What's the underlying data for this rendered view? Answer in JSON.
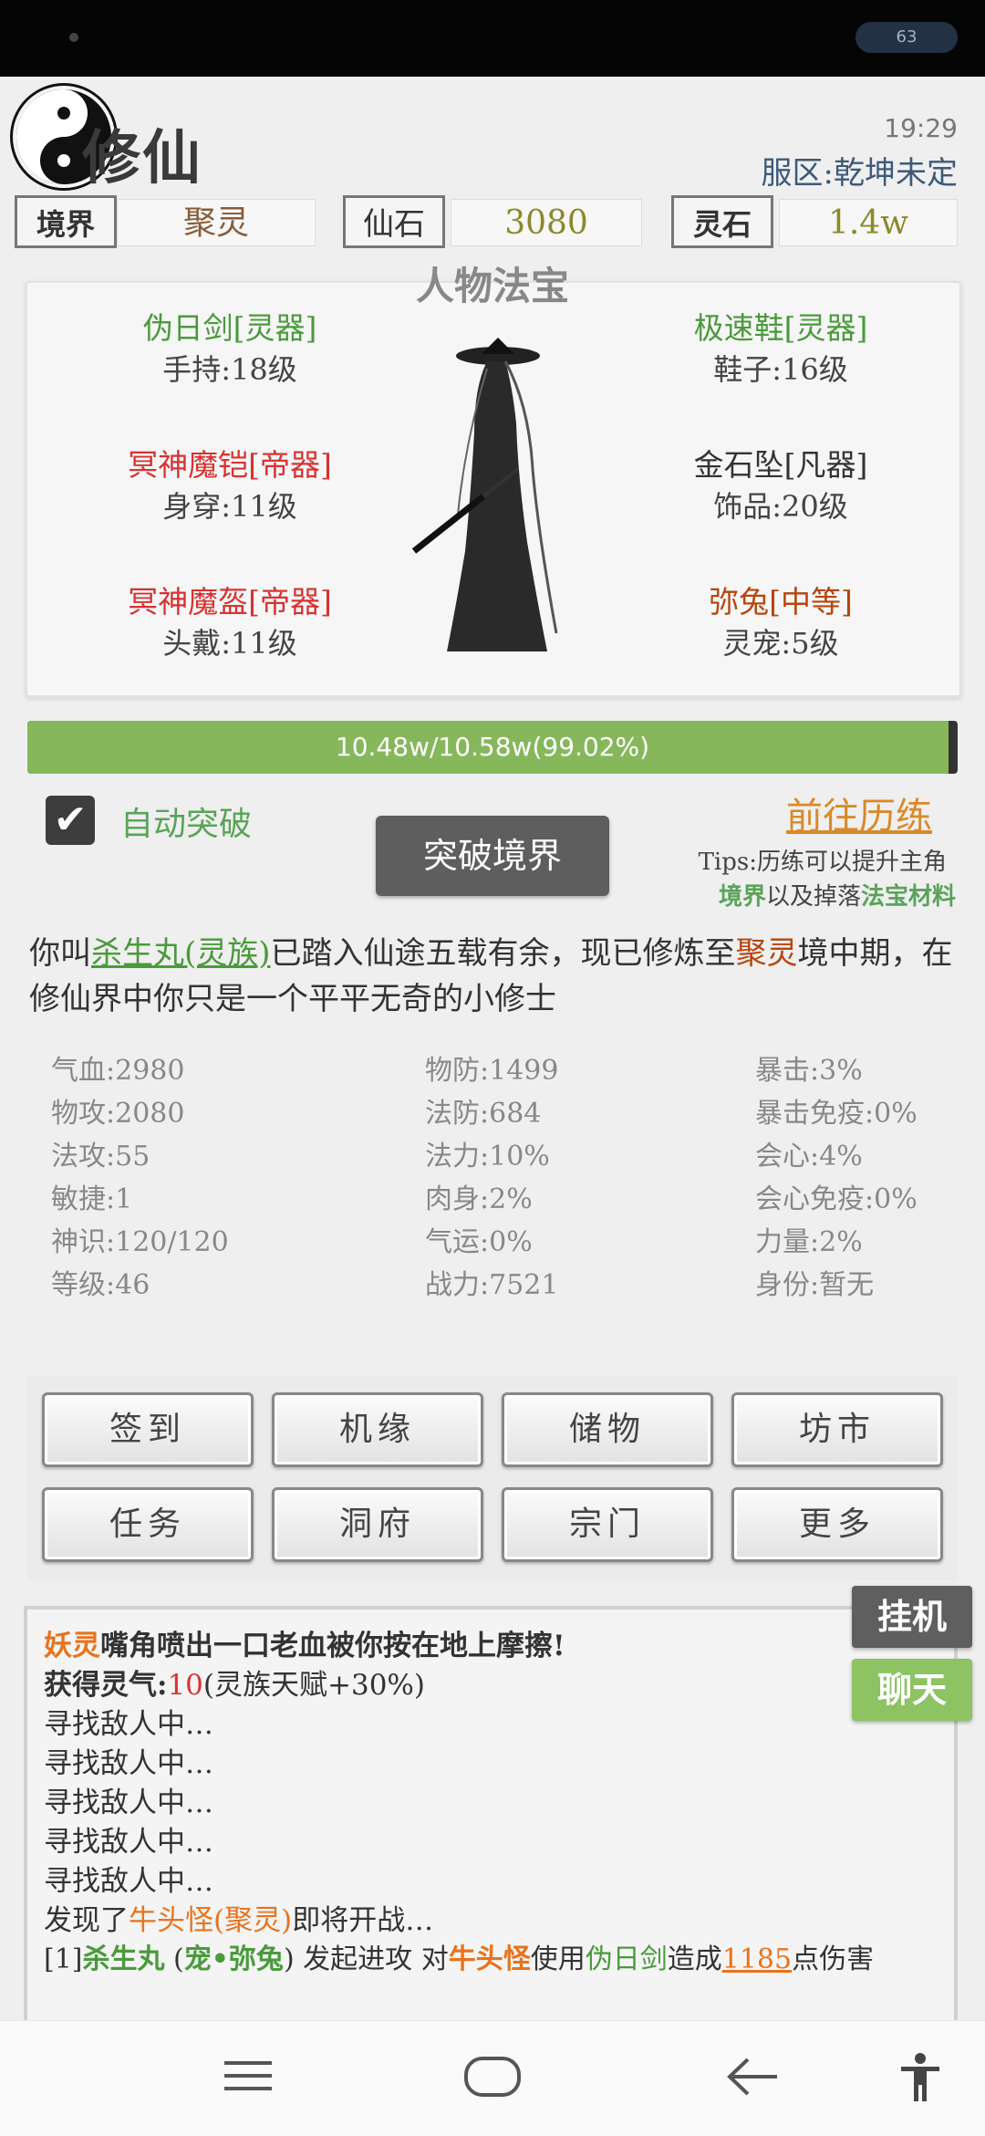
{
  "status_bar": {
    "battery": "63"
  },
  "header": {
    "title": "修仙",
    "time": "19:29",
    "server": "服区:乾坤未定"
  },
  "stats": {
    "realm_label": "境界",
    "realm_value": "聚灵",
    "xianshi_label": "仙石",
    "xianshi_value": "3080",
    "lingshi_label": "灵石",
    "lingshi_value": "1.4w"
  },
  "equipment": {
    "title": "人物法宝",
    "items": [
      {
        "name": "伪日剑[灵器]",
        "slot": "手持:18级",
        "color": "#4a9a3c"
      },
      {
        "name": "冥神魔铠[帝器]",
        "slot": "身穿:11级",
        "color": "#d83232"
      },
      {
        "name": "冥神魔盔[帝器]",
        "slot": "头戴:11级",
        "color": "#d83232"
      },
      {
        "name": "极速鞋[灵器]",
        "slot": "鞋子:16级",
        "color": "#4a9a3c"
      },
      {
        "name": "金石坠[凡器]",
        "slot": "饰品:20级",
        "color": "#333333"
      },
      {
        "name": "弥兔[中等]",
        "slot": "灵宠:5级",
        "color": "#b5460e"
      }
    ]
  },
  "progress": {
    "text": "10.48w/10.58w(99.02%)",
    "fraction": 0.9902
  },
  "auto": {
    "label": "自动突破",
    "checked": true
  },
  "breakthrough_label": "突破境界",
  "goto_label": "前往历练",
  "tips": {
    "line1": "Tips:历练可以提升主角",
    "line2a": "境界",
    "line2b": "以及掉落",
    "line2c": "法宝材料"
  },
  "description": {
    "p1": "你叫",
    "name": "杀生丸(灵族)",
    "p2": "已踏入仙途五载有余，现已修炼至",
    "realm": "聚灵",
    "p3": "境中期，在修仙界中你只是一个平平无奇的小修士"
  },
  "attributes": {
    "col1": [
      "气血:2980",
      "物攻:2080",
      "法攻:55",
      "敏捷:1",
      "神识:120/120",
      "等级:46"
    ],
    "col2": [
      "物防:1499",
      "法防:684",
      "法力:10%",
      "肉身:2%",
      "气运:0%",
      "战力:7521"
    ],
    "col3": [
      "暴击:3%",
      "暴击免疫:0%",
      "会心:4%",
      "会心免疫:0%",
      "力量:2%",
      "身份:暂无"
    ]
  },
  "buttons": [
    "签到",
    "机缘",
    "储物",
    "坊市",
    "任务",
    "洞府",
    "宗门",
    "更多"
  ],
  "log": {
    "l1a": "妖灵",
    "l1b": "嘴角喷出一口老血被你按在地上摩擦!",
    "l2a": "获得灵气:",
    "l2b": "10",
    "l2c": "(灵族天赋+30%)",
    "searching": [
      "寻找敌人中…",
      "寻找敌人中…",
      "寻找敌人中…",
      "寻找敌人中…",
      "寻找敌人中…"
    ],
    "l8a": "发现了",
    "l8b": "牛头怪(聚灵)",
    "l8c": "即将开战…",
    "l9a": "[1]",
    "l9b": "杀生丸",
    "l9c": " (",
    "l9d": "宠•弥兔",
    "l9e": ") 发起进攻 对",
    "l9f": "牛头怪",
    "l9g": "使用",
    "l9h": "伪日剑",
    "l9i": "造成",
    "l9j": "1185",
    "l9k": "点伤害"
  },
  "side": {
    "idle": "挂机",
    "chat": "聊天"
  }
}
